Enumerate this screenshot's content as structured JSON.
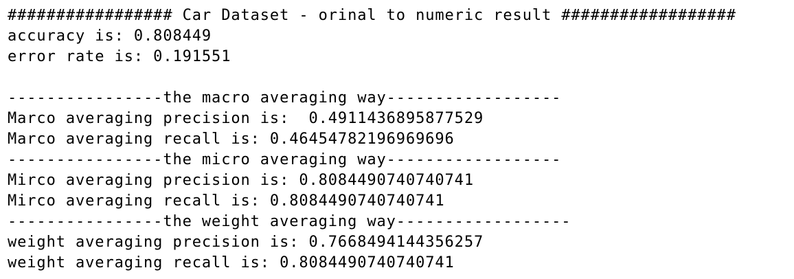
{
  "console": {
    "lines": [
      "################# Car Dataset - orinal to numeric result ##################",
      "accuracy is: 0.808449",
      "error rate is: 0.191551",
      "",
      "----------------the macro averaging way------------------",
      "Marco averaging precision is:  0.4911436895877529",
      "Marco averaging recall is: 0.46454782196969696",
      "----------------the micro averaging way------------------",
      "Mirco averaging precision is: 0.8084490740740741",
      "Mirco averaging recall is: 0.8084490740740741",
      "----------------the weight averaging way------------------",
      "weight averaging precision is: 0.7668494144356257",
      "weight averaging recall is: 0.8084490740740741"
    ]
  }
}
